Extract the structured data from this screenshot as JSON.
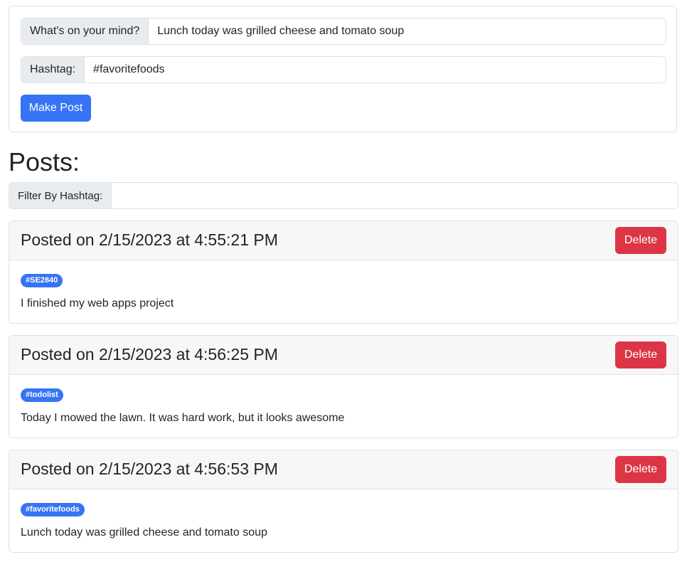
{
  "composer": {
    "mind_label": "What's on your mind?",
    "mind_value": "Lunch today was grilled cheese and tomato soup",
    "hashtag_label": "Hashtag:",
    "hashtag_value": "#favoritefoods",
    "submit_label": "Make Post"
  },
  "posts_heading": "Posts:",
  "filter": {
    "label": "Filter By Hashtag:",
    "value": ""
  },
  "posts": [
    {
      "title": "Posted on 2/15/2023 at 4:55:21 PM",
      "delete_label": "Delete",
      "hashtag": "#SE2840",
      "text": "I finished my web apps project"
    },
    {
      "title": "Posted on 2/15/2023 at 4:56:25 PM",
      "delete_label": "Delete",
      "hashtag": "#todolist",
      "text": "Today I mowed the lawn. It was hard work, but it looks awesome"
    },
    {
      "title": "Posted on 2/15/2023 at 4:56:53 PM",
      "delete_label": "Delete",
      "hashtag": "#favoritefoods",
      "text": "Lunch today was grilled cheese and tomato soup"
    }
  ],
  "colors": {
    "primary": "#3674f5",
    "danger": "#dc3545",
    "addon_bg": "#e9ecef",
    "header_bg": "#f7f7f7",
    "border": "#dee2e6"
  }
}
